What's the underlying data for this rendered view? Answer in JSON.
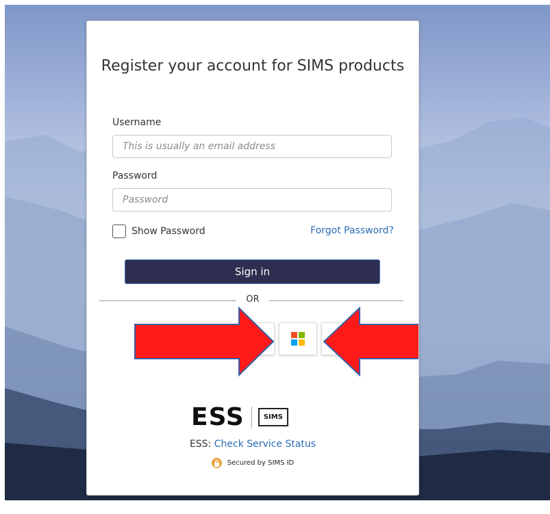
{
  "login": {
    "title": "Register your account for SIMS products",
    "username_label": "Username",
    "username_placeholder": "This is usually an email address",
    "password_label": "Password",
    "password_placeholder": "Password",
    "show_password_label": "Show Password",
    "forgot_password_link": "Forgot Password?",
    "sign_in_button": "Sign in",
    "or_divider": "OR"
  },
  "providers": [
    {
      "name": "Microsoft",
      "icon": "microsoft-logo-icon"
    }
  ],
  "footer": {
    "brand_logo_text": "ESS",
    "brand_sub_logo_text": "SIMS",
    "status_prefix": "ESS:",
    "status_link": "Check Service Status",
    "secured_text": "Secured by SIMS ID"
  },
  "annotations": {
    "arrow_color": "#ff0000",
    "arrow_outline": "#3a5fa8"
  },
  "colors": {
    "sign_in_bg": "#2e2e50",
    "link": "#2c6cb3",
    "ms_red": "#f25022",
    "ms_green": "#7fba00",
    "ms_blue": "#00a4ef",
    "ms_yellow": "#ffb900"
  }
}
